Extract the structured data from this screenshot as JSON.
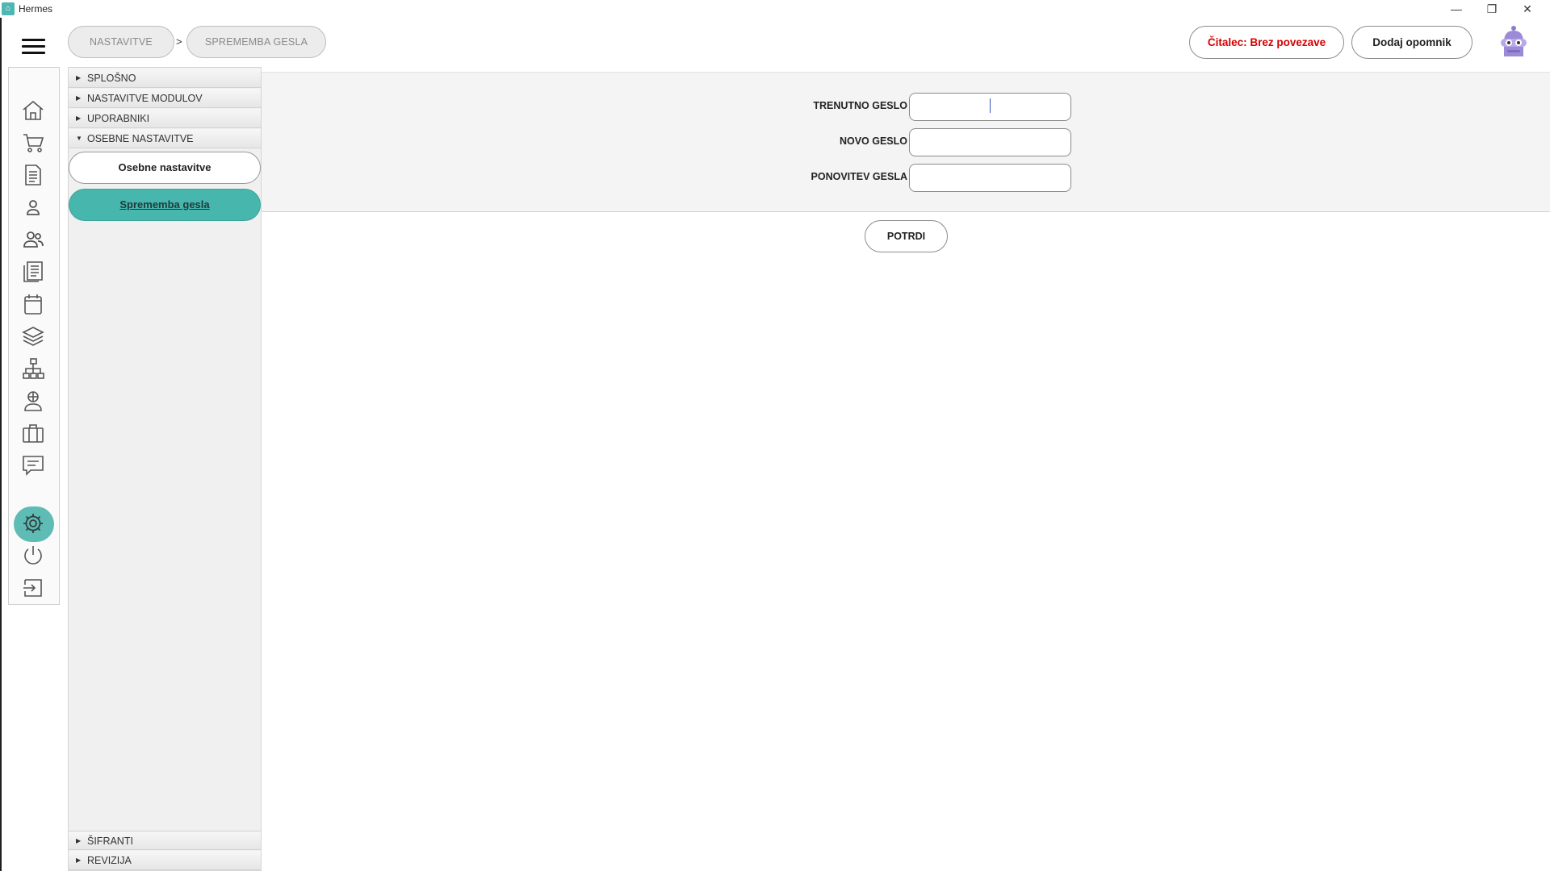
{
  "window": {
    "title": "Hermes"
  },
  "breadcrumb": {
    "items": [
      "NASTAVITVE",
      "SPREMEMBA GESLA"
    ],
    "separator": ">"
  },
  "header": {
    "reader_status": "Čitalec: Brez povezave",
    "reader_status_color": "#d40000",
    "add_reminder": "Dodaj opomnik"
  },
  "nav_icons": [
    "home-icon",
    "cart-icon",
    "document-icon",
    "person-icon",
    "people-icon",
    "newspaper-icon",
    "calendar-icon",
    "layers-icon",
    "network-icon",
    "user-support-icon",
    "briefcase-icon",
    "chat-icon",
    "gear-icon",
    "power-icon",
    "logout-icon"
  ],
  "tree": {
    "sections_top": [
      "SPLOŠNO",
      "NASTAVITVE MODULOV",
      "UPORABNIKI",
      "OSEBNE NASTAVITVE"
    ],
    "sub_items": [
      "Osebne nastavitve",
      "Sprememba gesla"
    ],
    "sections_bottom": [
      "ŠIFRANTI",
      "REVIZIJA"
    ]
  },
  "form": {
    "current_label": "TRENUTNO GESLO",
    "new_label": "NOVO GESLO",
    "repeat_label": "PONOVITEV GESLA",
    "current_value": "",
    "new_value": "",
    "repeat_value": "",
    "confirm_label": "POTRDI"
  },
  "colors": {
    "accent": "#47b6ad",
    "panel": "#f4f4f4"
  }
}
